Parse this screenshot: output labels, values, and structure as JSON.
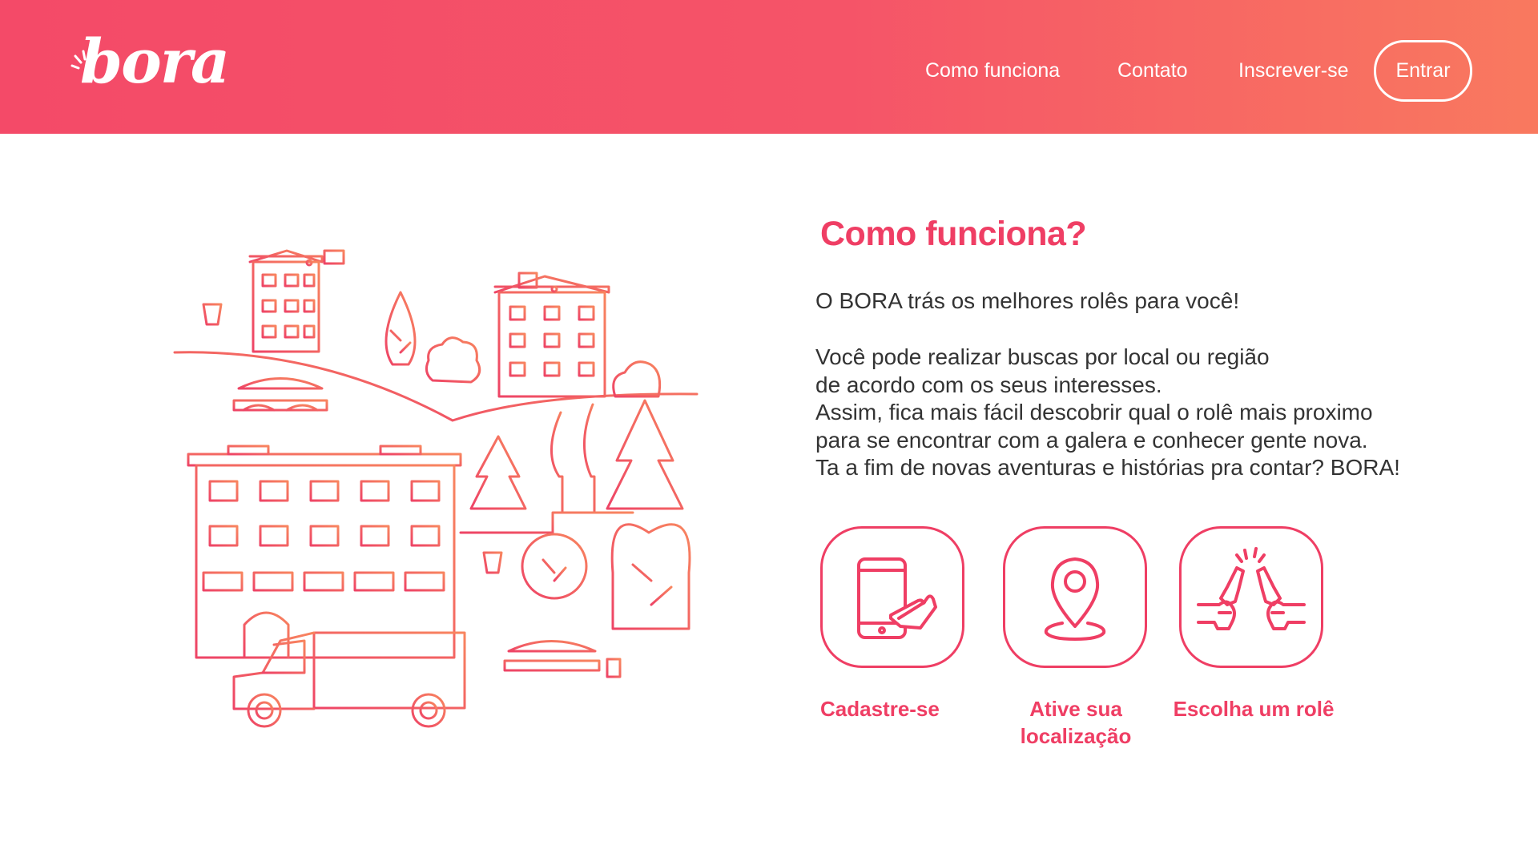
{
  "header": {
    "logo_text": "bora",
    "nav": {
      "how_it_works": "Como funciona",
      "contact": "Contato",
      "signup": "Inscrever-se",
      "login": "Entrar"
    }
  },
  "colors": {
    "brand": "#f44a68",
    "brand_end": "#f9795f",
    "accent": "#ef3e64",
    "text": "#333333"
  },
  "main": {
    "title": "Como funciona?",
    "intro": "O BORA trás os melhores rolês para você!",
    "body_lines": [
      "Você pode realizar buscas por local ou região",
      "de acordo com os seus interesses.",
      "Assim, fica mais fácil descobrir qual o rolê mais proximo",
      "para se encontrar com a galera e conhecer gente nova.",
      "Ta a fim de novas aventuras e histórias pra contar? BORA!"
    ],
    "steps": [
      {
        "label": "Cadastre-se",
        "icon": "phone-tap-icon"
      },
      {
        "label": "Ative sua localização",
        "icon": "location-pin-icon"
      },
      {
        "label": "Escolha um rolê",
        "icon": "cheers-icon"
      }
    ]
  }
}
